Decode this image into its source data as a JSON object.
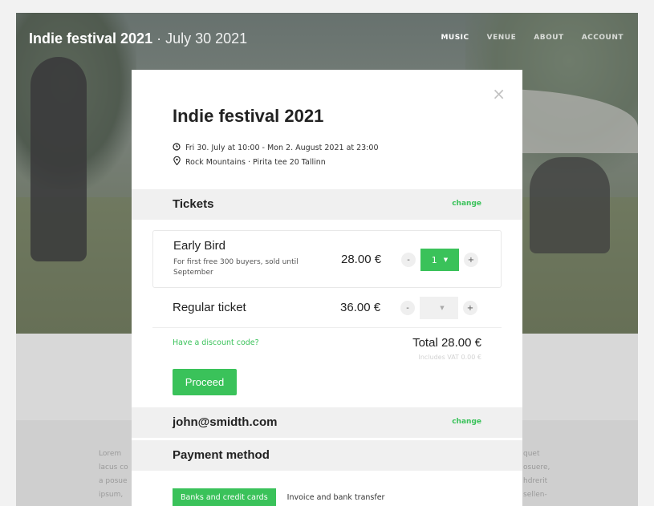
{
  "hero": {
    "title": "Indie festival 2021",
    "date": " · July 30 2021",
    "nav": [
      "MUSIC",
      "VENUE",
      "ABOUT",
      "ACCOUNT"
    ]
  },
  "lorem": {
    "left": [
      "Lorem",
      "lacus co",
      "a posue",
      "ipsum,"
    ],
    "right": [
      "quet",
      "osuere,",
      "hdrerit",
      "sellen-"
    ]
  },
  "modal": {
    "close": "×",
    "title": "Indie festival 2021",
    "datetime": "Fri 30. July at 10:00 - Mon 2. August 2021 at 23:00",
    "location": "Rock Mountains · Pirita tee 20 Tallinn",
    "tickets_heading": "Tickets",
    "tickets_change": "change",
    "tickets": [
      {
        "name": "Early Bird",
        "description": "For first free 300 buyers, sold until September",
        "price": "28.00 €",
        "minus": "-",
        "plus": "+",
        "quantity": "1"
      },
      {
        "name": "Regular ticket",
        "price": "36.00 €",
        "minus": "-",
        "plus": "+",
        "quantity": ""
      }
    ],
    "discount_link": "Have a discount code?",
    "total": "Total 28.00 €",
    "vat": "Includes VAT 0.00 €",
    "proceed_label": "Proceed",
    "email": "john@smidth.com",
    "email_change": "change",
    "payment_heading": "Payment method",
    "payment_tabs": [
      "Banks and credit cards",
      "Invoice and bank transfer"
    ]
  },
  "colors": {
    "accent": "#3ac25a",
    "section_bg": "#f0f0f0"
  },
  "icons": {
    "clock": "clock-icon",
    "location": "location-pin-icon",
    "caret": "caret-down-icon",
    "close": "close-icon"
  }
}
